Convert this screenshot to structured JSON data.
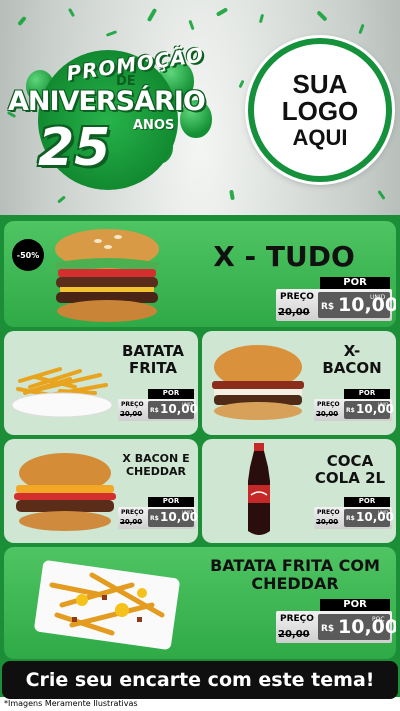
{
  "header": {
    "promo": {
      "line1": "PROMOÇÃO",
      "line2": "DE",
      "line3": "ANIVERSÁRIO",
      "number": "25",
      "anos": "ANOS"
    },
    "logo": {
      "line1": "SUA",
      "line2": "LOGO",
      "line3": "AQUI"
    }
  },
  "featured": {
    "discount": "-50%",
    "title": "X - TUDO",
    "por": "POR",
    "preco_label": "PREÇO",
    "old_price": "20,00",
    "currency": "R$",
    "new_price": "10,00",
    "unit": "UNID"
  },
  "items": [
    {
      "title": "BATATA FRITA",
      "por": "POR",
      "preco_label": "PREÇO",
      "old_price": "20,00",
      "currency": "R$",
      "new_price": "10,00",
      "unit": "UNID"
    },
    {
      "title": "X- BACON",
      "por": "POR",
      "preco_label": "PREÇO",
      "old_price": "20,00",
      "currency": "R$",
      "new_price": "10,00",
      "unit": "UNID"
    },
    {
      "title": "X BACON E CHEDDAR",
      "por": "POR",
      "preco_label": "PREÇO",
      "old_price": "20,00",
      "currency": "R$",
      "new_price": "10,00",
      "unit": "UNID"
    },
    {
      "title": "COCA COLA 2L",
      "por": "POR",
      "preco_label": "PREÇO",
      "old_price": "20,00",
      "currency": "R$",
      "new_price": "10,00",
      "unit": "UNID"
    }
  ],
  "bottom_item": {
    "title": "BATATA FRITA COM CHEDDAR",
    "por": "POR",
    "preco_label": "PREÇO",
    "old_price": "20,00",
    "currency": "R$",
    "new_price": "10,00",
    "unit": "POÇ"
  },
  "cta": "Crie seu encarte com este tema!",
  "disclaimer": "*Imagens Meramente Ilustrativas",
  "colors": {
    "brand_green": "#1c8e37",
    "card_green": "#3fb654",
    "light_card": "#cfe6d2",
    "black": "#000000"
  }
}
